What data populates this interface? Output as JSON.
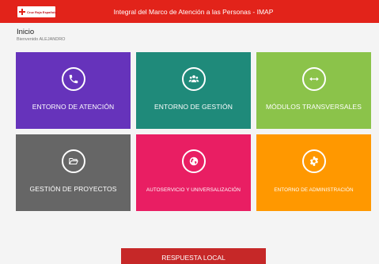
{
  "header": {
    "logo_text": "Cruz Roja Española",
    "title": "Integral del Marco de Atención a las Personas - IMAP",
    "color": "#e2231a"
  },
  "breadcrumb": {
    "title": "Inicio",
    "welcome": "Bienvenido ALEJANDRO"
  },
  "tiles": [
    {
      "label": "ENTORNO DE ATENCIÓN",
      "icon": "phone-icon",
      "color": "#6633bb"
    },
    {
      "label": "ENTORNO DE GESTIÓN",
      "icon": "users-icon",
      "color": "#1f8a7a"
    },
    {
      "label": "MÓDULOS TRANSVERSALES",
      "icon": "arrows-horizontal-icon",
      "color": "#8bc34a"
    },
    {
      "label": "GESTIÓN DE PROYECTOS",
      "icon": "folder-open-icon",
      "color": "#666666"
    },
    {
      "label": "AUTOSERVICIO Y UNIVERSALIZACIÓN",
      "icon": "globe-icon",
      "color": "#e91e63"
    },
    {
      "label": "ENTORNO DE ADMINISTRACIÓN",
      "icon": "gear-icon",
      "color": "#ff9800"
    }
  ],
  "footer": {
    "button_label": "RESPUESTA LOCAL",
    "color": "#c62828"
  }
}
